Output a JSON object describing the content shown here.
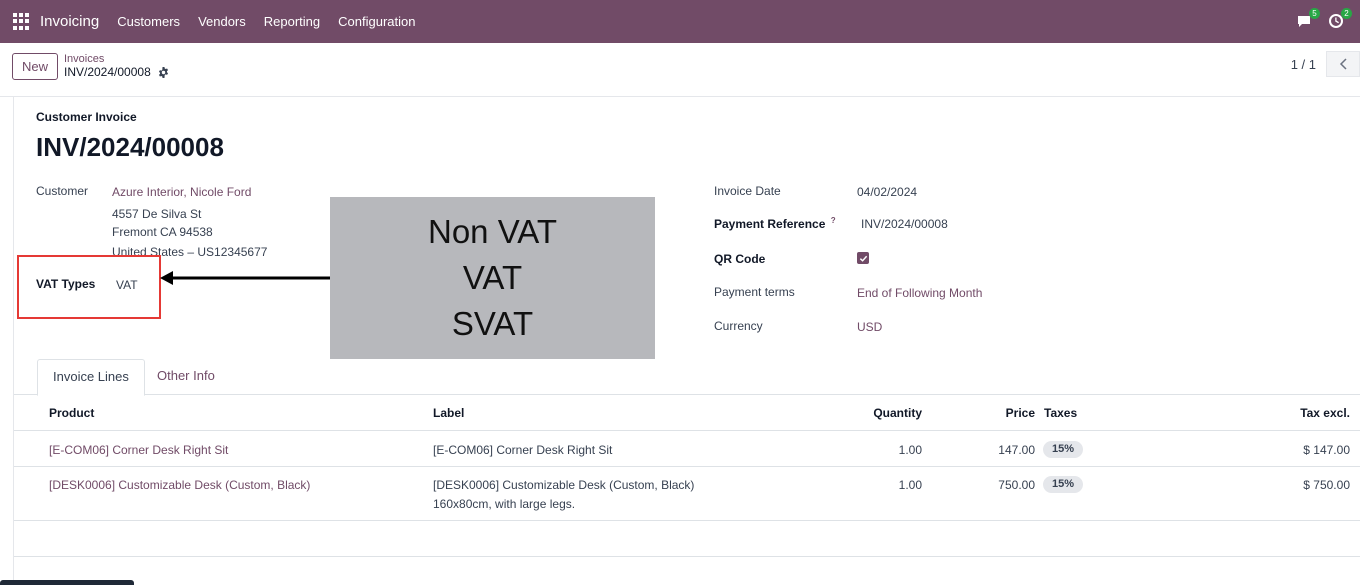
{
  "navbar": {
    "app_name": "Invoicing",
    "menu": [
      "Customers",
      "Vendors",
      "Reporting",
      "Configuration"
    ],
    "messages_count": "5",
    "activities_count": "2"
  },
  "control_panel": {
    "new_label": "New",
    "breadcrumb_parent": "Invoices",
    "breadcrumb_current": "INV/2024/00008",
    "pager_value": "1 / 1"
  },
  "form": {
    "doc_type": "Customer Invoice",
    "doc_name": "INV/2024/00008",
    "customer_label": "Customer",
    "customer_name": "Azure Interior, Nicole Ford",
    "address_line1": "4557 De Silva St",
    "address_line2": "Fremont CA 94538",
    "address_line3": "United States – US12345677",
    "vat_types_label": "VAT Types",
    "vat_types_value": "VAT",
    "invoice_date_label": "Invoice Date",
    "invoice_date_value": "04/02/2024",
    "payment_ref_label": "Payment Reference",
    "payment_ref_tooltip": "?",
    "payment_ref_value": "INV/2024/00008",
    "qr_code_label": "QR Code",
    "payment_terms_label": "Payment terms",
    "payment_terms_value": "End of Following Month",
    "currency_label": "Currency",
    "currency_value": "USD"
  },
  "annotation": {
    "options": [
      "Non VAT",
      "VAT",
      "SVAT"
    ]
  },
  "tabs": [
    "Invoice Lines",
    "Other Info"
  ],
  "table": {
    "headers": {
      "product": "Product",
      "label": "Label",
      "quantity": "Quantity",
      "price": "Price",
      "taxes": "Taxes",
      "tax_excl": "Tax excl."
    },
    "rows": [
      {
        "product": "[E-COM06] Corner Desk Right Sit",
        "label": "[E-COM06] Corner Desk Right Sit",
        "label2": "",
        "quantity": "1.00",
        "price": "147.00",
        "tax": "15%",
        "subtotal": "$ 147.00"
      },
      {
        "product": "[DESK0006] Customizable Desk (Custom, Black)",
        "label": "[DESK0006] Customizable Desk (Custom, Black)",
        "label2": "160x80cm, with large legs.",
        "quantity": "1.00",
        "price": "750.00",
        "tax": "15%",
        "subtotal": "$ 750.00"
      }
    ]
  },
  "colors": {
    "brand": "#714b67",
    "highlight": "#e53935",
    "annotation_bg": "#b7b8bc"
  }
}
